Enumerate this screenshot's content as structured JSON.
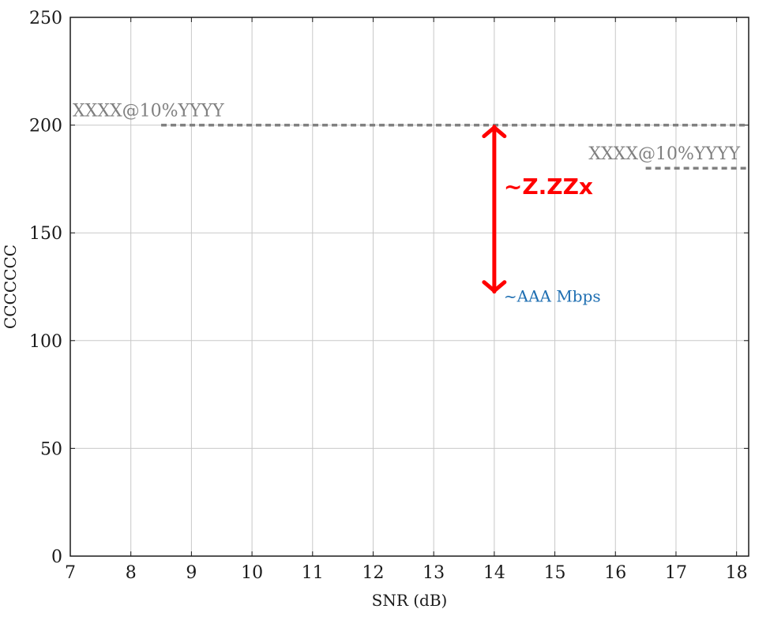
{
  "chart_data": {
    "type": "line",
    "title": "",
    "xlabel": "SNR (dB)",
    "ylabel": "CCCCCCC",
    "xlim": [
      7,
      18.2
    ],
    "ylim": [
      0,
      250
    ],
    "xticks": [
      7,
      8,
      9,
      10,
      11,
      12,
      13,
      14,
      15,
      16,
      17,
      18
    ],
    "yticks": [
      0,
      50,
      100,
      150,
      200,
      250
    ],
    "grid": true,
    "series": [
      {
        "label": "XXXX@10%YYYY",
        "x": [
          8.5,
          18.2
        ],
        "y": [
          200,
          200
        ],
        "color": "#808080",
        "style": "dashed"
      },
      {
        "label": "XXXX@10%YYYY",
        "x": [
          16.5,
          18.2
        ],
        "y": [
          180,
          180
        ],
        "color": "#808080",
        "style": "dashed"
      }
    ],
    "annotations": {
      "gap_arrow": {
        "x": 14,
        "y_from": 200,
        "y_to": 122,
        "color": "#ff0000"
      },
      "gap_label": {
        "text": "~Z.ZZx",
        "color": "#ff0000"
      },
      "throughput_label": {
        "text": "~AAA Mbps",
        "color": "#1f6fb2"
      }
    }
  }
}
